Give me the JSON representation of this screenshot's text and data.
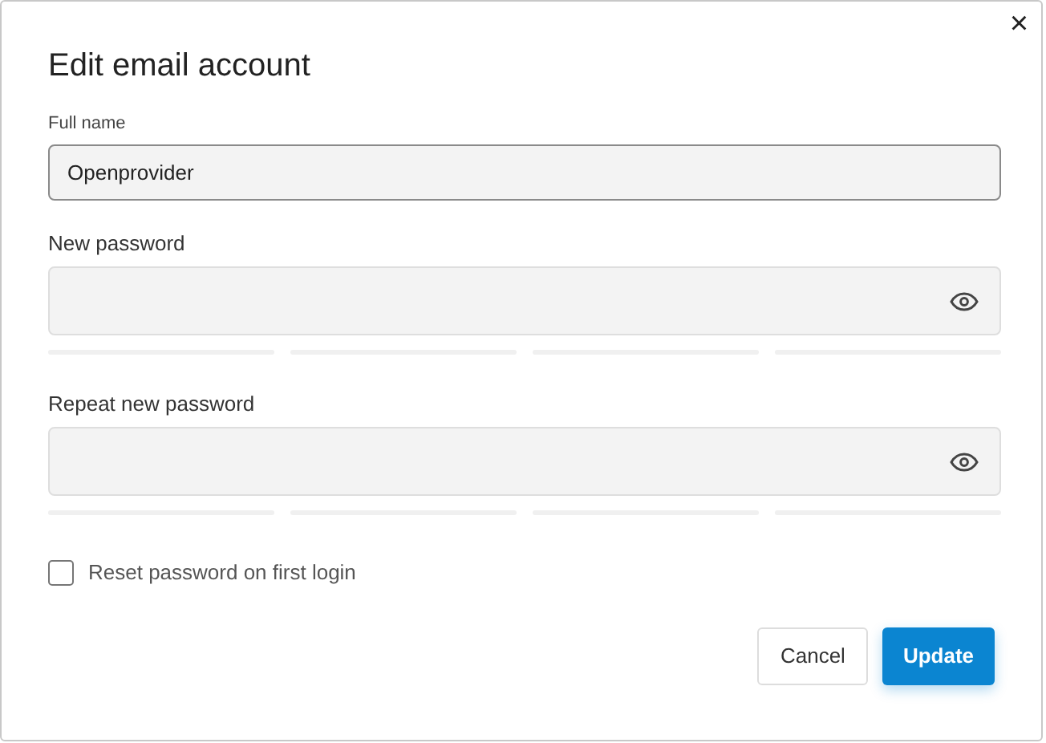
{
  "dialog": {
    "title": "Edit email account",
    "close": "×"
  },
  "full_name": {
    "label": "Full name",
    "value": "Openprovider"
  },
  "password_fields": [
    {
      "label": "New password"
    },
    {
      "label": "Repeat new password"
    }
  ],
  "reset_checkbox": {
    "label": "Reset password on first login",
    "checked": false
  },
  "buttons": [
    {
      "label": "Cancel",
      "kind": "secondary"
    },
    {
      "label": "Update",
      "kind": "primary"
    }
  ]
}
